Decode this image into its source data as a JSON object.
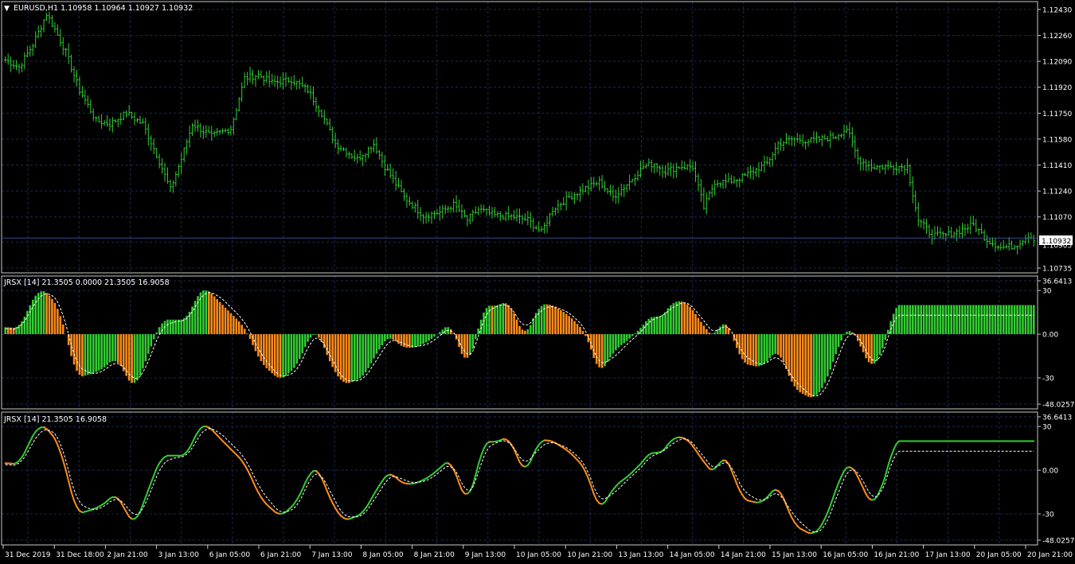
{
  "colors": {
    "background": "#000000",
    "grid": "#1c2a55",
    "frame": "#c8c8c8",
    "axis_text": "#ffffff",
    "price_bars": "#32cd32",
    "current_price_line": "#3a4a8a",
    "rising": "#32cd32",
    "falling": "#ff8c1a",
    "signal": "#ffffff"
  },
  "main_panel": {
    "symbol_label": "EURUSD,H1  1.10958 1.10964 1.10927 1.10932",
    "last_price": "1.10932"
  },
  "osc_panel_1": {
    "label": "JRSX [14] 21.3505 0.0000 21.3505 16.9058"
  },
  "osc_panel_2": {
    "label": "JRSX [14] 21.3505 16.9058"
  },
  "chart_data": [
    {
      "type": "ohlc",
      "symbol": "EURUSD",
      "timeframe": "H1",
      "ylim": [
        1.10735,
        1.1245
      ],
      "yticks": [
        "1.12430",
        "1.12260",
        "1.12090",
        "1.11920",
        "1.11750",
        "1.11580",
        "1.11410",
        "1.11240",
        "1.11070",
        "1.10905",
        "1.10735"
      ],
      "xticks": [
        "31 Dec 2019",
        "31 Dec 18:00",
        "2 Jan 21:00",
        "3 Jan 13:00",
        "6 Jan 05:00",
        "6 Jan 21:00",
        "7 Jan 13:00",
        "8 Jan 05:00",
        "8 Jan 21:00",
        "9 Jan 13:00",
        "10 Jan 05:00",
        "10 Jan 21:00",
        "13 Jan 13:00",
        "14 Jan 05:00",
        "14 Jan 21:00",
        "15 Jan 13:00",
        "16 Jan 05:00",
        "16 Jan 21:00",
        "17 Jan 13:00",
        "20 Jan 05:00",
        "20 Jan 21:00"
      ],
      "close_path": [
        [
          0,
          1.121
        ],
        [
          5,
          1.1205
        ],
        [
          10,
          1.122
        ],
        [
          15,
          1.124
        ],
        [
          18,
          1.123
        ],
        [
          22,
          1.1215
        ],
        [
          27,
          1.119
        ],
        [
          33,
          1.117
        ],
        [
          38,
          1.1168
        ],
        [
          44,
          1.1175
        ],
        [
          50,
          1.1168
        ],
        [
          55,
          1.1148
        ],
        [
          60,
          1.1125
        ],
        [
          64,
          1.1145
        ],
        [
          68,
          1.1168
        ],
        [
          75,
          1.116
        ],
        [
          82,
          1.1165
        ],
        [
          87,
          1.1198
        ],
        [
          92,
          1.12
        ],
        [
          97,
          1.1195
        ],
        [
          104,
          1.1197
        ],
        [
          110,
          1.119
        ],
        [
          115,
          1.1175
        ],
        [
          120,
          1.1155
        ],
        [
          128,
          1.1145
        ],
        [
          134,
          1.1155
        ],
        [
          138,
          1.114
        ],
        [
          145,
          1.112
        ],
        [
          152,
          1.1108
        ],
        [
          158,
          1.111
        ],
        [
          163,
          1.1115
        ],
        [
          168,
          1.1105
        ],
        [
          172,
          1.1112
        ],
        [
          178,
          1.1108
        ],
        [
          185,
          1.1107
        ],
        [
          190,
          1.1105
        ],
        [
          195,
          1.1097
        ],
        [
          199,
          1.1112
        ],
        [
          205,
          1.112
        ],
        [
          210,
          1.1125
        ],
        [
          216,
          1.113
        ],
        [
          221,
          1.112
        ],
        [
          227,
          1.113
        ],
        [
          232,
          1.114
        ],
        [
          236,
          1.1142
        ],
        [
          240,
          1.1137
        ],
        [
          245,
          1.114
        ],
        [
          250,
          1.114
        ],
        [
          254,
          1.1113
        ],
        [
          258,
          1.113
        ],
        [
          263,
          1.113
        ],
        [
          268,
          1.1133
        ],
        [
          273,
          1.1138
        ],
        [
          277,
          1.1142
        ],
        [
          281,
          1.1155
        ],
        [
          286,
          1.1158
        ],
        [
          292,
          1.1157
        ],
        [
          297,
          1.1158
        ],
        [
          302,
          1.116
        ],
        [
          306,
          1.1165
        ],
        [
          310,
          1.1145
        ],
        [
          315,
          1.114
        ],
        [
          322,
          1.114
        ],
        [
          328,
          1.114
        ],
        [
          332,
          1.1105
        ],
        [
          337,
          1.1095
        ],
        [
          342,
          1.1095
        ],
        [
          347,
          1.1098
        ],
        [
          352,
          1.1102
        ],
        [
          357,
          1.1092
        ],
        [
          362,
          1.1087
        ],
        [
          367,
          1.1088
        ],
        [
          372,
          1.1095
        ],
        [
          374,
          1.1093
        ]
      ]
    },
    {
      "type": "histogram",
      "name": "JRSX [14]",
      "ylim": [
        -48.0257,
        36.6413
      ],
      "ytick_values": [
        36.6413,
        30,
        0,
        -30,
        -48.0257
      ],
      "yticks": [
        "36.6413",
        "30",
        "0.00",
        "-30",
        "-48.0257"
      ],
      "jrsx_path": [
        [
          0,
          5
        ],
        [
          5,
          4
        ],
        [
          9,
          20
        ],
        [
          12,
          31
        ],
        [
          16,
          28
        ],
        [
          20,
          15
        ],
        [
          26,
          -30
        ],
        [
          32,
          -27
        ],
        [
          37,
          -22
        ],
        [
          40,
          -15
        ],
        [
          44,
          -29
        ],
        [
          47,
          -38
        ],
        [
          50,
          -24
        ],
        [
          54,
          -3
        ],
        [
          57,
          10
        ],
        [
          62,
          10
        ],
        [
          66,
          10
        ],
        [
          70,
          28
        ],
        [
          73,
          32
        ],
        [
          78,
          22
        ],
        [
          87,
          5
        ],
        [
          93,
          -20
        ],
        [
          100,
          -32
        ],
        [
          106,
          -22
        ],
        [
          111,
          0
        ],
        [
          114,
          1
        ],
        [
          118,
          -20
        ],
        [
          123,
          -35
        ],
        [
          130,
          -30
        ],
        [
          136,
          -10
        ],
        [
          140,
          0
        ],
        [
          143,
          -8
        ],
        [
          148,
          -10
        ],
        [
          154,
          -5
        ],
        [
          162,
          8
        ],
        [
          165,
          -10
        ],
        [
          168,
          -22
        ],
        [
          171,
          -5
        ],
        [
          174,
          20
        ],
        [
          178,
          19
        ],
        [
          183,
          23
        ],
        [
          189,
          -3
        ],
        [
          194,
          20
        ],
        [
          198,
          21
        ],
        [
          205,
          13
        ],
        [
          211,
          1
        ],
        [
          216,
          -28
        ],
        [
          222,
          -10
        ],
        [
          226,
          -5
        ],
        [
          232,
          6
        ],
        [
          235,
          14
        ],
        [
          238,
          10
        ],
        [
          243,
          23
        ],
        [
          248,
          22
        ],
        [
          255,
          3
        ],
        [
          258,
          -3
        ],
        [
          261,
          12
        ],
        [
          264,
          1
        ],
        [
          268,
          -20
        ],
        [
          275,
          -23
        ],
        [
          281,
          -10
        ],
        [
          287,
          -38
        ],
        [
          294,
          -45
        ],
        [
          298,
          -35
        ],
        [
          304,
          -3
        ],
        [
          307,
          6
        ],
        [
          311,
          -8
        ],
        [
          315,
          -25
        ],
        [
          318,
          -15
        ],
        [
          321,
          0
        ],
        [
          323,
          20
        ]
      ],
      "signal_path": [
        [
          0,
          4
        ],
        [
          5,
          3
        ],
        [
          9,
          15
        ],
        [
          12,
          26
        ],
        [
          16,
          29
        ],
        [
          20,
          21
        ],
        [
          26,
          -22
        ],
        [
          32,
          -28
        ],
        [
          37,
          -24
        ],
        [
          40,
          -18
        ],
        [
          44,
          -24
        ],
        [
          47,
          -33
        ],
        [
          50,
          -28
        ],
        [
          54,
          -9
        ],
        [
          57,
          5
        ],
        [
          62,
          9
        ],
        [
          66,
          9
        ],
        [
          70,
          22
        ],
        [
          73,
          30
        ],
        [
          78,
          26
        ],
        [
          87,
          9
        ],
        [
          93,
          -14
        ],
        [
          100,
          -30
        ],
        [
          106,
          -26
        ],
        [
          111,
          -5
        ],
        [
          114,
          0
        ],
        [
          118,
          -14
        ],
        [
          123,
          -32
        ],
        [
          130,
          -32
        ],
        [
          136,
          -15
        ],
        [
          140,
          -3
        ],
        [
          143,
          -5
        ],
        [
          148,
          -9
        ],
        [
          154,
          -7
        ],
        [
          162,
          5
        ],
        [
          165,
          -4
        ],
        [
          168,
          -18
        ],
        [
          171,
          -10
        ],
        [
          174,
          13
        ],
        [
          178,
          19
        ],
        [
          183,
          21
        ],
        [
          189,
          3
        ],
        [
          194,
          15
        ],
        [
          198,
          20
        ],
        [
          205,
          15
        ],
        [
          211,
          4
        ],
        [
          216,
          -22
        ],
        [
          222,
          -15
        ],
        [
          226,
          -7
        ],
        [
          232,
          3
        ],
        [
          235,
          11
        ],
        [
          238,
          11
        ],
        [
          243,
          19
        ],
        [
          248,
          23
        ],
        [
          255,
          7
        ],
        [
          258,
          -1
        ],
        [
          261,
          7
        ],
        [
          264,
          4
        ],
        [
          268,
          -14
        ],
        [
          275,
          -22
        ],
        [
          281,
          -14
        ],
        [
          287,
          -32
        ],
        [
          294,
          -44
        ],
        [
          298,
          -40
        ],
        [
          304,
          -10
        ],
        [
          307,
          3
        ],
        [
          311,
          -3
        ],
        [
          315,
          -20
        ],
        [
          318,
          -18
        ],
        [
          321,
          -5
        ],
        [
          323,
          13
        ]
      ]
    },
    {
      "type": "line",
      "name": "JRSX [14]",
      "ylim": [
        -48.0257,
        36.6413
      ],
      "ytick_values": [
        36.6413,
        30,
        0,
        -30,
        -48.0257
      ],
      "yticks": [
        "36.6413",
        "30",
        "0.00",
        "-30",
        "-48.0257"
      ]
    }
  ]
}
